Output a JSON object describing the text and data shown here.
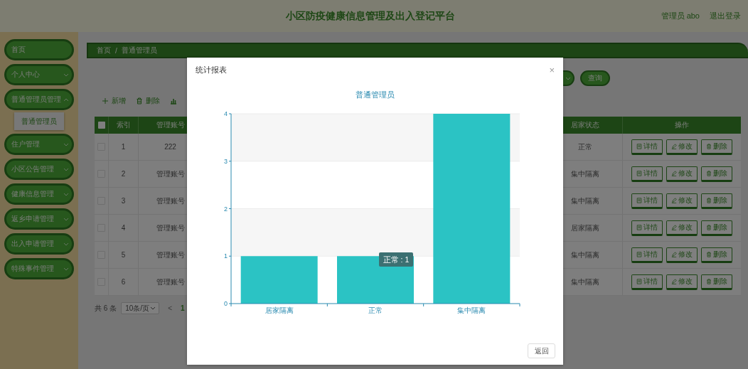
{
  "header": {
    "title": "小区防疫健康信息管理及出入登记平台",
    "user": "管理员 abo",
    "logout": "退出登录"
  },
  "sidebar": {
    "items": [
      {
        "label": "首页",
        "kind": "link"
      },
      {
        "label": "个人中心",
        "kind": "menu",
        "expanded": false
      },
      {
        "label": "普通管理员管理",
        "kind": "menu",
        "expanded": true,
        "children": [
          {
            "label": "普通管理员"
          }
        ]
      },
      {
        "label": "住户管理",
        "kind": "menu",
        "expanded": false
      },
      {
        "label": "小区公告管理",
        "kind": "menu",
        "expanded": false
      },
      {
        "label": "健康信息管理",
        "kind": "menu",
        "expanded": false
      },
      {
        "label": "返乡申请管理",
        "kind": "menu",
        "expanded": false
      },
      {
        "label": "出入申请管理",
        "kind": "menu",
        "expanded": false
      },
      {
        "label": "特殊事件管理",
        "kind": "menu",
        "expanded": false
      }
    ]
  },
  "breadcrumb": {
    "items": [
      "首页",
      "普通管理员"
    ],
    "separator": "/"
  },
  "search": {
    "button": "查询"
  },
  "toolbar": [
    {
      "label": "新增",
      "kind": "add"
    },
    {
      "label": "删除",
      "kind": "delete"
    },
    {
      "kind": "chart"
    }
  ],
  "table": {
    "header_checked": false,
    "columns": [
      "索引",
      "管理账号",
      "居家状态",
      "操作"
    ],
    "rows": [
      {
        "checked": false,
        "index": "1",
        "account": "222",
        "status": "正常",
        "actions": [
          {
            "label": "详情",
            "kind": "detail"
          },
          {
            "label": "修改",
            "kind": "edit"
          },
          {
            "label": "删除",
            "kind": "delete"
          }
        ]
      },
      {
        "checked": false,
        "index": "2",
        "account": "管理账号",
        "status": "集中隔离",
        "actions": [
          {
            "label": "详情",
            "kind": "detail"
          },
          {
            "label": "修改",
            "kind": "edit"
          },
          {
            "label": "删除",
            "kind": "delete"
          }
        ]
      },
      {
        "checked": false,
        "index": "3",
        "account": "管理账号",
        "status": "集中隔离",
        "actions": [
          {
            "label": "详情",
            "kind": "detail"
          },
          {
            "label": "修改",
            "kind": "edit"
          },
          {
            "label": "删除",
            "kind": "delete"
          }
        ]
      },
      {
        "checked": false,
        "index": "4",
        "account": "管理账号",
        "status": "居家隔离",
        "actions": [
          {
            "label": "详情",
            "kind": "detail"
          },
          {
            "label": "修改",
            "kind": "edit"
          },
          {
            "label": "删除",
            "kind": "delete"
          }
        ]
      },
      {
        "checked": false,
        "index": "5",
        "account": "管理账号",
        "status": "集中隔离",
        "actions": [
          {
            "label": "详情",
            "kind": "detail"
          },
          {
            "label": "修改",
            "kind": "edit"
          },
          {
            "label": "删除",
            "kind": "delete"
          }
        ]
      },
      {
        "checked": false,
        "index": "6",
        "account": "管理账号",
        "status": "集中隔离",
        "actions": [
          {
            "label": "详情",
            "kind": "detail"
          },
          {
            "label": "修改",
            "kind": "edit"
          },
          {
            "label": "删除",
            "kind": "delete"
          }
        ]
      }
    ]
  },
  "pagination": {
    "total": "共 6 条",
    "page_size": "10条/页",
    "prev": "<",
    "pages": [
      {
        "label": "1",
        "selected": true
      }
    ]
  },
  "modal": {
    "title": "统计报表",
    "close": "×",
    "tooltip": "正常 : 1",
    "button": "返回",
    "chart_data": {
      "type": "bar",
      "title": "普通管理员",
      "categories": [
        "居家隔离",
        "正常",
        "集中隔离"
      ],
      "values": [
        1,
        1,
        4
      ],
      "ylim": [
        0,
        4
      ],
      "yticks": [
        0,
        1,
        2,
        3,
        4
      ],
      "grid": true
    }
  }
}
